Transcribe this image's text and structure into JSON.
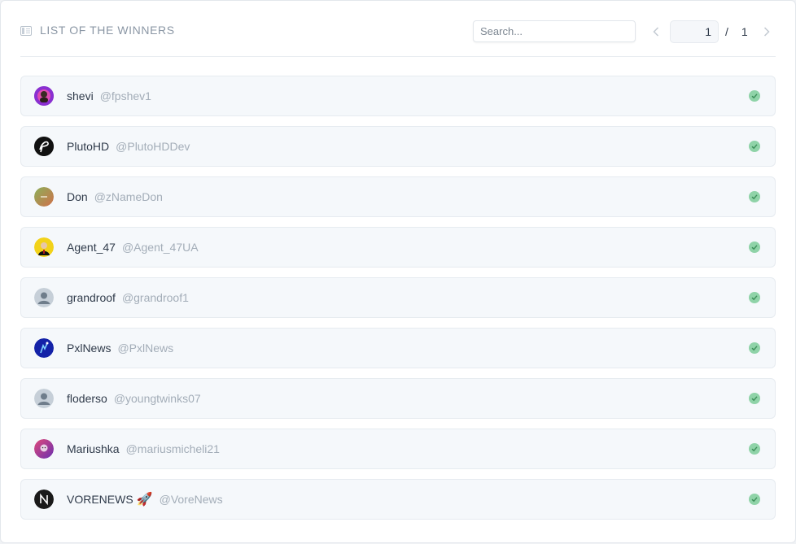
{
  "header": {
    "title": "LIST OF THE WINNERS",
    "title_icon": "list-icon"
  },
  "search": {
    "placeholder": "Search...",
    "value": ""
  },
  "pagination": {
    "current_page": "1",
    "separator": "/",
    "total_pages": "1"
  },
  "winners": [
    {
      "name": "shevi",
      "handle": "@fpshev1",
      "avatar": "avatar-shevi",
      "avatar_color": "#7b2fbe"
    },
    {
      "name": "PlutoHD",
      "handle": "@PlutoHDDev",
      "avatar": "avatar-plutohd",
      "avatar_color": "#111111"
    },
    {
      "name": "Don",
      "handle": "@zNameDon",
      "avatar": "avatar-don",
      "avatar_color": "#7fa05a"
    },
    {
      "name": "Agent_47",
      "handle": "@Agent_47UA",
      "avatar": "avatar-agent47",
      "avatar_color": "#f2d21a"
    },
    {
      "name": "grandroof",
      "handle": "@grandroof1",
      "avatar": "default-user-icon",
      "avatar_color": "#c6cfd8"
    },
    {
      "name": "PxlNews",
      "handle": "@PxlNews",
      "avatar": "avatar-pxlnews",
      "avatar_color": "#1422a8"
    },
    {
      "name": "floderso",
      "handle": "@youngtwinks07",
      "avatar": "default-user-icon",
      "avatar_color": "#c6cfd8"
    },
    {
      "name": "Mariushka",
      "handle": "@mariusmicheli21",
      "avatar": "avatar-mariushka",
      "avatar_color": "#b0368e"
    },
    {
      "name": "VORENEWS",
      "emoji": "🚀",
      "handle": "@VoreNews",
      "avatar": "avatar-vorenews",
      "avatar_color": "#1a1a1a"
    }
  ],
  "colors": {
    "check": "#8fd3a8",
    "row_bg": "#f5f8fb",
    "muted_text": "#a3adb8",
    "title_text": "#8b97a5"
  }
}
